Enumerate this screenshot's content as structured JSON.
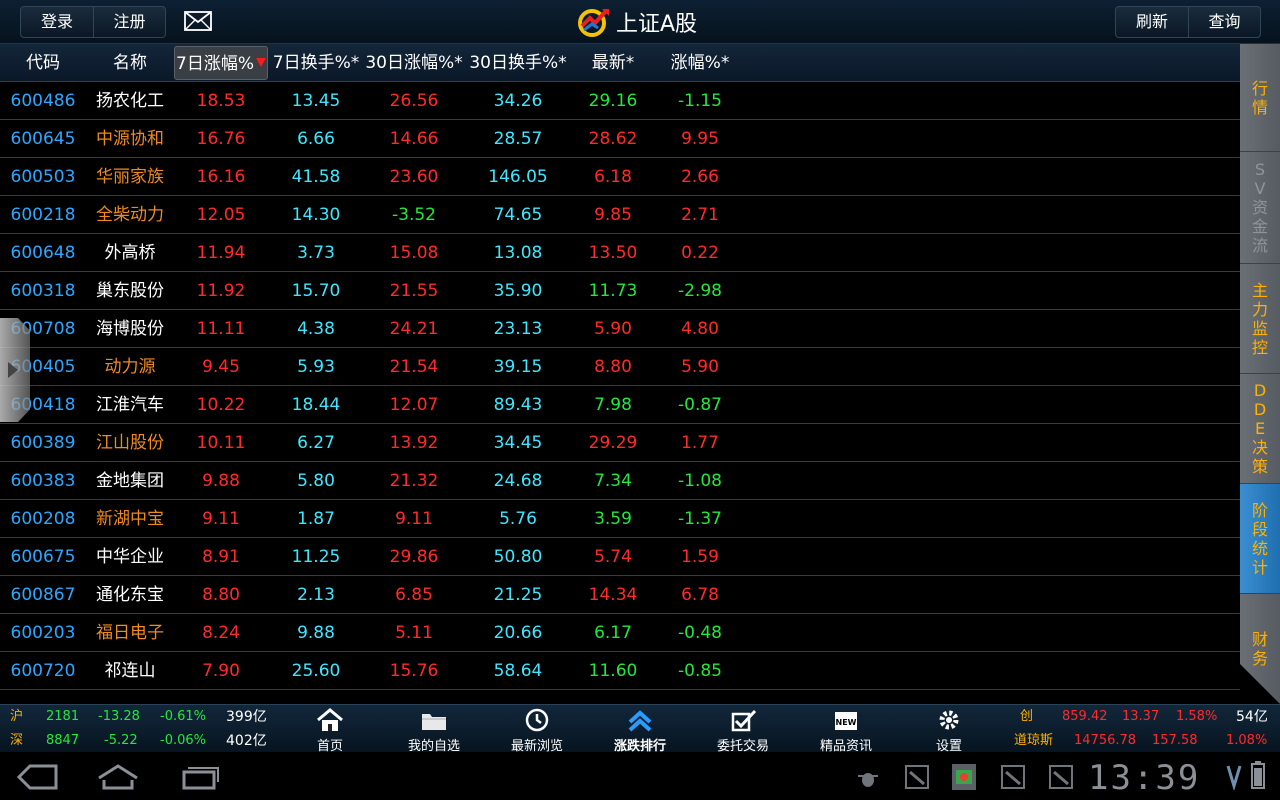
{
  "topbar": {
    "login_label": "登录",
    "register_label": "注册",
    "title": "上证A股",
    "refresh_label": "刷新",
    "query_label": "查询",
    "mail_icon": "mail-icon",
    "logo_icon": "app-logo-icon"
  },
  "table": {
    "headers": [
      "代码",
      "名称",
      "7日涨幅%",
      "7日换手%*",
      "30日涨幅%*",
      "30日换手%*",
      "最新*",
      "涨幅%*"
    ],
    "sort_indicator": "sort-desc-red-arrow",
    "rows": [
      {
        "code": "600486",
        "name": "扬农化工",
        "name_color": "white",
        "c1": "18.53",
        "c2": "13.45",
        "c3": "26.56",
        "c3_color": "red",
        "c4": "34.26",
        "c5": "29.16",
        "c5_color": "green",
        "c6": "-1.15",
        "c6_color": "green"
      },
      {
        "code": "600645",
        "name": "中源协和",
        "name_color": "orange",
        "c1": "16.76",
        "c2": "6.66",
        "c3": "14.66",
        "c3_color": "red",
        "c4": "28.57",
        "c5": "28.62",
        "c5_color": "red",
        "c6": "9.95",
        "c6_color": "red"
      },
      {
        "code": "600503",
        "name": "华丽家族",
        "name_color": "orange",
        "c1": "16.16",
        "c2": "41.58",
        "c3": "23.60",
        "c3_color": "red",
        "c4": "146.05",
        "c5": "6.18",
        "c5_color": "red",
        "c6": "2.66",
        "c6_color": "red"
      },
      {
        "code": "600218",
        "name": "全柴动力",
        "name_color": "orange",
        "c1": "12.05",
        "c2": "14.30",
        "c3": "-3.52",
        "c3_color": "green",
        "c4": "74.65",
        "c5": "9.85",
        "c5_color": "red",
        "c6": "2.71",
        "c6_color": "red"
      },
      {
        "code": "600648",
        "name": "外高桥",
        "name_color": "white",
        "c1": "11.94",
        "c2": "3.73",
        "c3": "15.08",
        "c3_color": "red",
        "c4": "13.08",
        "c5": "13.50",
        "c5_color": "red",
        "c6": "0.22",
        "c6_color": "red"
      },
      {
        "code": "600318",
        "name": "巢东股份",
        "name_color": "white",
        "c1": "11.92",
        "c2": "15.70",
        "c3": "21.55",
        "c3_color": "red",
        "c4": "35.90",
        "c5": "11.73",
        "c5_color": "green",
        "c6": "-2.98",
        "c6_color": "green"
      },
      {
        "code": "600708",
        "name": "海博股份",
        "name_color": "white",
        "c1": "11.11",
        "c2": "4.38",
        "c3": "24.21",
        "c3_color": "red",
        "c4": "23.13",
        "c5": "5.90",
        "c5_color": "red",
        "c6": "4.80",
        "c6_color": "red"
      },
      {
        "code": "600405",
        "name": "动力源",
        "name_color": "orange",
        "c1": "9.45",
        "c2": "5.93",
        "c3": "21.54",
        "c3_color": "red",
        "c4": "39.15",
        "c5": "8.80",
        "c5_color": "red",
        "c6": "5.90",
        "c6_color": "red"
      },
      {
        "code": "600418",
        "name": "江淮汽车",
        "name_color": "white",
        "c1": "10.22",
        "c2": "18.44",
        "c3": "12.07",
        "c3_color": "red",
        "c4": "89.43",
        "c5": "7.98",
        "c5_color": "green",
        "c6": "-0.87",
        "c6_color": "green"
      },
      {
        "code": "600389",
        "name": "江山股份",
        "name_color": "orange",
        "c1": "10.11",
        "c2": "6.27",
        "c3": "13.92",
        "c3_color": "red",
        "c4": "34.45",
        "c5": "29.29",
        "c5_color": "red",
        "c6": "1.77",
        "c6_color": "red"
      },
      {
        "code": "600383",
        "name": "金地集团",
        "name_color": "white",
        "c1": "9.88",
        "c2": "5.80",
        "c3": "21.32",
        "c3_color": "red",
        "c4": "24.68",
        "c5": "7.34",
        "c5_color": "green",
        "c6": "-1.08",
        "c6_color": "green"
      },
      {
        "code": "600208",
        "name": "新湖中宝",
        "name_color": "orange",
        "c1": "9.11",
        "c2": "1.87",
        "c3": "9.11",
        "c3_color": "red",
        "c4": "5.76",
        "c5": "3.59",
        "c5_color": "green",
        "c6": "-1.37",
        "c6_color": "green"
      },
      {
        "code": "600675",
        "name": "中华企业",
        "name_color": "white",
        "c1": "8.91",
        "c2": "11.25",
        "c3": "29.86",
        "c3_color": "red",
        "c4": "50.80",
        "c5": "5.74",
        "c5_color": "red",
        "c6": "1.59",
        "c6_color": "red"
      },
      {
        "code": "600867",
        "name": "通化东宝",
        "name_color": "white",
        "c1": "8.80",
        "c2": "2.13",
        "c3": "6.85",
        "c3_color": "red",
        "c4": "21.25",
        "c5": "14.34",
        "c5_color": "red",
        "c6": "6.78",
        "c6_color": "red"
      },
      {
        "code": "600203",
        "name": "福日电子",
        "name_color": "orange",
        "c1": "8.24",
        "c2": "9.88",
        "c3": "5.11",
        "c3_color": "red",
        "c4": "20.66",
        "c5": "6.17",
        "c5_color": "green",
        "c6": "-0.48",
        "c6_color": "green"
      },
      {
        "code": "600720",
        "name": "祁连山",
        "name_color": "white",
        "c1": "7.90",
        "c2": "25.60",
        "c3": "15.76",
        "c3_color": "red",
        "c4": "58.64",
        "c5": "11.60",
        "c5_color": "green",
        "c6": "-0.85",
        "c6_color": "green"
      }
    ]
  },
  "sidebar": {
    "tabs": [
      {
        "label": "行情",
        "state": "normal"
      },
      {
        "label": "SV资金流",
        "state": "disabled"
      },
      {
        "label": "主力监控",
        "state": "normal"
      },
      {
        "label": "DDE决策",
        "state": "normal"
      },
      {
        "label": "阶段统计",
        "state": "active"
      },
      {
        "label": "财务",
        "state": "normal"
      }
    ]
  },
  "ticker": {
    "sh": {
      "label": "沪",
      "points": "2181",
      "change": "-13.28",
      "pct": "-0.61%",
      "volume": "399亿"
    },
    "sz": {
      "label": "深",
      "points": "8847",
      "change": "-5.22",
      "pct": "-0.06%",
      "volume": "402亿"
    },
    "cy": {
      "label": "创",
      "points": "859.42",
      "change": "13.37",
      "pct": "1.58%",
      "volume": "54亿"
    },
    "dj": {
      "label": "道琼斯",
      "points": "14756.78",
      "change": "157.58",
      "pct": "1.08%"
    }
  },
  "nav": {
    "items": [
      {
        "label": "首页",
        "icon": "home-icon"
      },
      {
        "label": "我的自选",
        "icon": "folder-icon"
      },
      {
        "label": "最新浏览",
        "icon": "clock-icon"
      },
      {
        "label": "涨跌排行",
        "icon": "ranking-icon"
      },
      {
        "label": "委托交易",
        "icon": "checkbox-icon"
      },
      {
        "label": "精品资讯",
        "icon": "news-icon"
      },
      {
        "label": "设置",
        "icon": "gear-icon"
      }
    ],
    "active_index": 3,
    "news_badge": "NEW"
  },
  "system": {
    "time": "13:39"
  },
  "colors": {
    "red": "#ff2a2a",
    "green": "#22e83a",
    "cyan": "#3ee7ff",
    "code_blue": "#2aa8ff",
    "orange": "#f08a1c",
    "sidebar_active": "#2f80c4",
    "sidebar_label": "#ffb000"
  }
}
